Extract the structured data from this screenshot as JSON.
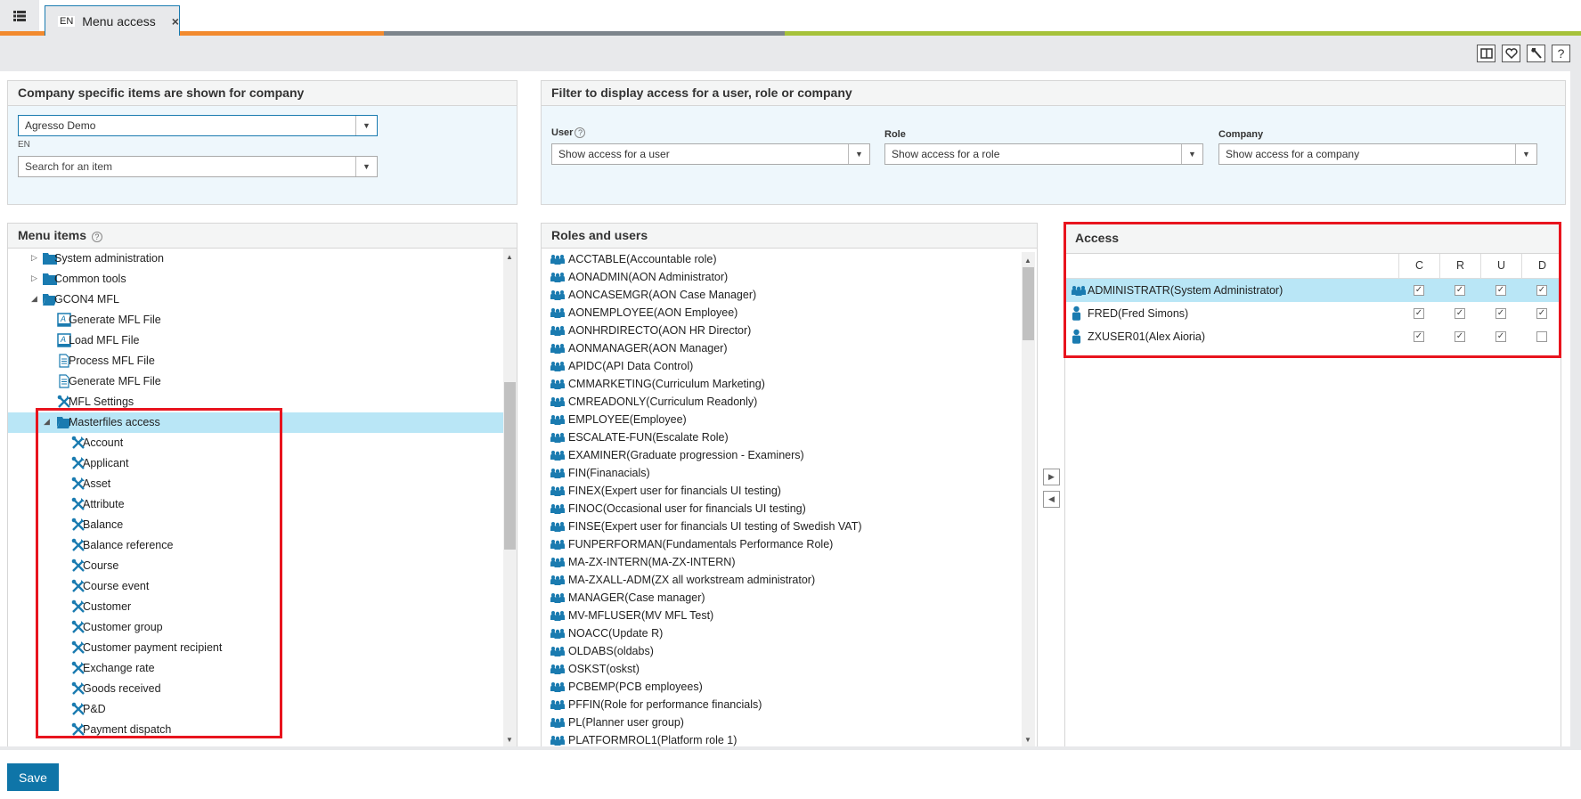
{
  "tab": {
    "lang": "EN",
    "title": "Menu access",
    "close": "×"
  },
  "colors": {
    "stripe_orange": "#f28a2e",
    "stripe_gray": "#7d858c",
    "stripe_green": "#a6c23a",
    "accent": "#0f75a8",
    "selection": "#b9e6f6",
    "highlight_box": "#e8141e"
  },
  "toolbar": {
    "icons": [
      "split-view-icon",
      "favorite-heart-icon",
      "wrench-icon",
      "help-icon"
    ],
    "help_label": "?"
  },
  "company_panel": {
    "title": "Company specific items are shown for company",
    "company_value": "Agresso Demo",
    "language": "EN",
    "search_placeholder": "Search for an item"
  },
  "filter_panel": {
    "title": "Filter to display access for a user, role or company",
    "user_label": "User",
    "user_placeholder": "Show access for a user",
    "role_label": "Role",
    "role_placeholder": "Show access for a role",
    "company_label": "Company",
    "company_placeholder": "Show access for a company"
  },
  "menu_items": {
    "title": "Menu items",
    "help": "?",
    "rows": [
      {
        "label": "System administration",
        "level": 0,
        "icon": "folder",
        "toggle": "collapsed"
      },
      {
        "label": "Common tools",
        "level": 0,
        "icon": "folder",
        "toggle": "collapsed"
      },
      {
        "label": "GCON4 MFL",
        "level": 0,
        "icon": "folder-open",
        "toggle": "expanded"
      },
      {
        "label": "Generate MFL File",
        "level": 1,
        "icon": "form"
      },
      {
        "label": "Load MFL File",
        "level": 1,
        "icon": "form"
      },
      {
        "label": "Process MFL File",
        "level": 1,
        "icon": "document"
      },
      {
        "label": "Generate MFL File",
        "level": 1,
        "icon": "document"
      },
      {
        "label": "MFL Settings",
        "level": 1,
        "icon": "tools"
      },
      {
        "label": "Masterfiles access",
        "level": 1,
        "icon": "folder-open",
        "toggle": "expanded",
        "selected": true
      },
      {
        "label": "Account",
        "level": 2,
        "icon": "tools"
      },
      {
        "label": "Applicant",
        "level": 2,
        "icon": "tools"
      },
      {
        "label": "Asset",
        "level": 2,
        "icon": "tools"
      },
      {
        "label": "Attribute",
        "level": 2,
        "icon": "tools"
      },
      {
        "label": "Balance",
        "level": 2,
        "icon": "tools"
      },
      {
        "label": "Balance reference",
        "level": 2,
        "icon": "tools"
      },
      {
        "label": "Course",
        "level": 2,
        "icon": "tools"
      },
      {
        "label": "Course event",
        "level": 2,
        "icon": "tools"
      },
      {
        "label": "Customer",
        "level": 2,
        "icon": "tools"
      },
      {
        "label": "Customer group",
        "level": 2,
        "icon": "tools"
      },
      {
        "label": "Customer payment recipient",
        "level": 2,
        "icon": "tools"
      },
      {
        "label": "Exchange rate",
        "level": 2,
        "icon": "tools"
      },
      {
        "label": "Goods received",
        "level": 2,
        "icon": "tools"
      },
      {
        "label": "P&D",
        "level": 2,
        "icon": "tools"
      },
      {
        "label": "Payment dispatch",
        "level": 2,
        "icon": "tools"
      }
    ]
  },
  "roles_users": {
    "title": "Roles and users",
    "rows": [
      "ACCTABLE(Accountable role)",
      "AONADMIN(AON Administrator)",
      "AONCASEMGR(AON Case Manager)",
      "AONEMPLOYEE(AON Employee)",
      "AONHRDIRECTO(AON HR Director)",
      "AONMANAGER(AON Manager)",
      "APIDC(API Data Control)",
      "CMMARKETING(Curriculum Marketing)",
      "CMREADONLY(Curriculum Readonly)",
      "EMPLOYEE(Employee)",
      "ESCALATE-FUN(Escalate Role)",
      "EXAMINER(Graduate progression - Examiners)",
      "FIN(Finanacials)",
      "FINEX(Expert user for financials UI testing)",
      "FINOC(Occasional user for financials UI testing)",
      "FINSE(Expert user for financials UI testing of Swedish VAT)",
      "FUNPERFORMAN(Fundamentals Performance Role)",
      "MA-ZX-INTERN(MA-ZX-INTERN)",
      "MA-ZXALL-ADM(ZX all workstream administrator)",
      "MANAGER(Case manager)",
      "MV-MFLUSER(MV MFL Test)",
      "NOACC(Update R)",
      "OLDABS(oldabs)",
      "OSKST(oskst)",
      "PCBEMP(PCB employees)",
      "PFFIN(Role for performance financials)",
      "PL(Planner user group)",
      "PLATFORMROL1(Platform role 1)"
    ]
  },
  "access": {
    "title": "Access",
    "columns": [
      "C",
      "R",
      "U",
      "D"
    ],
    "rows": [
      {
        "name": "ADMINISTRATR(System Administrator)",
        "type": "role",
        "selected": true,
        "perms": [
          true,
          true,
          true,
          true
        ]
      },
      {
        "name": "FRED(Fred Simons)",
        "type": "user",
        "perms": [
          true,
          true,
          true,
          true
        ]
      },
      {
        "name": "ZXUSER01(Alex Aioria)",
        "type": "user",
        "perms": [
          true,
          true,
          true,
          false
        ]
      }
    ]
  },
  "footer": {
    "save_label": "Save"
  }
}
